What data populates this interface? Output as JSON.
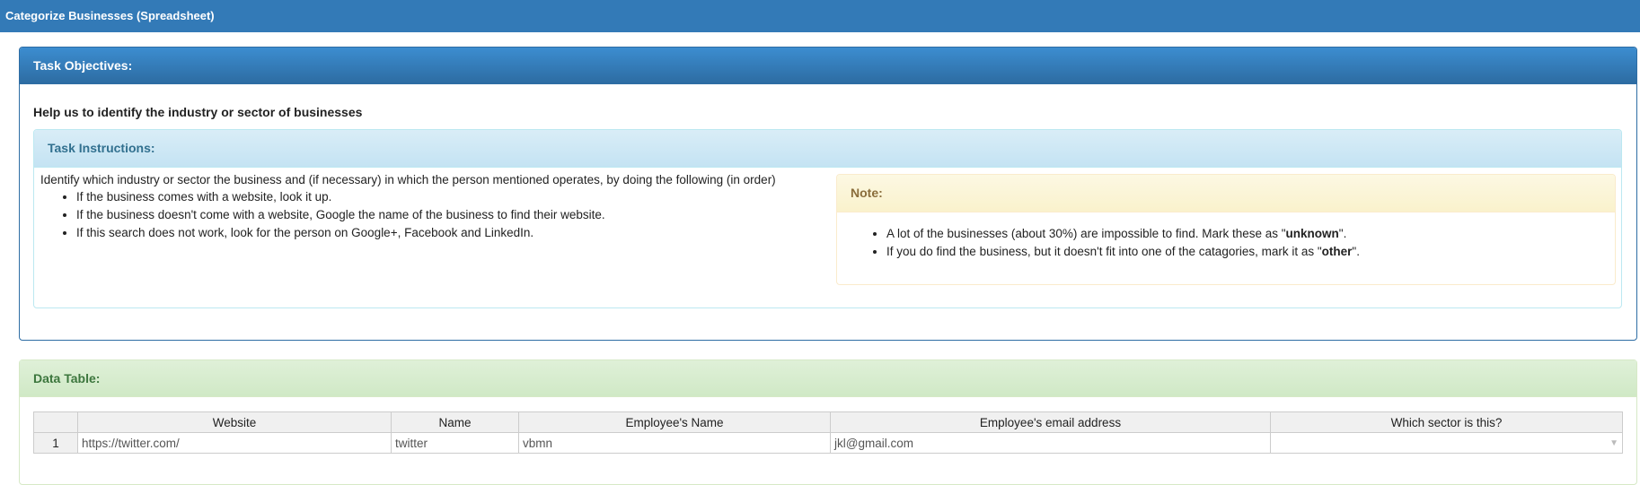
{
  "app": {
    "title": "Categorize Businesses (Spreadsheet)"
  },
  "objectives": {
    "heading": "Task Objectives:",
    "subtitle": "Help us to identify the industry or sector of businesses"
  },
  "instructions": {
    "heading": "Task Instructions:",
    "intro": "Identify which industry or sector the business and (if necessary) in which the person mentioned operates, by doing the following (in order)",
    "steps": [
      "If the business comes with a website, look it up.",
      "If the business doesn't come with a website, Google the name of the business to find their website.",
      "If this search does not work, look for the person on Google+, Facebook and LinkedIn."
    ]
  },
  "note": {
    "heading": "Note:",
    "item1_prefix": "A lot of the businesses (about 30%) are impossible to find. Mark these as \"",
    "item1_bold": "unknown",
    "item1_suffix": "\".",
    "item2_prefix": "If you do find the business, but it doesn't fit into one of the catagories, mark it as \"",
    "item2_bold": "other",
    "item2_suffix": "\"."
  },
  "data_table": {
    "heading": "Data Table:",
    "columns": [
      "Website",
      "Name",
      "Employee's Name",
      "Employee's email address",
      "Which sector is this?"
    ],
    "rows": [
      {
        "num": "1",
        "website": "https://twitter.com/",
        "name": "twitter",
        "employee_name": "vbmn",
        "email": "jkl@gmail.com",
        "sector": ""
      }
    ]
  },
  "icons": {
    "dropdown": "chevron-down-icon"
  }
}
